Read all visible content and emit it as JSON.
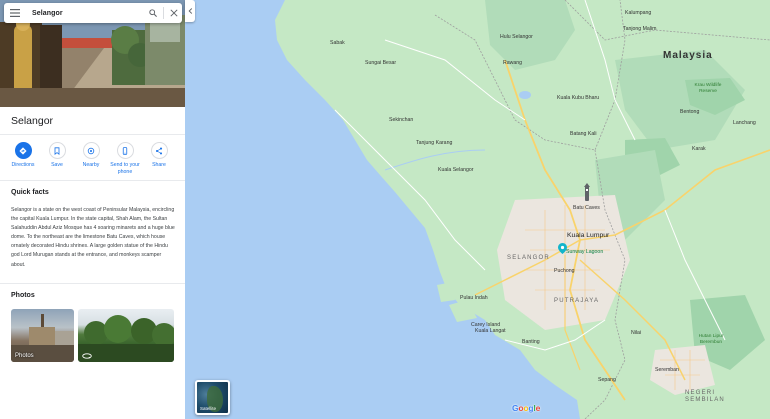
{
  "search": {
    "query": "Selangor"
  },
  "place": {
    "title": "Selangor"
  },
  "actions": [
    {
      "label": "Directions"
    },
    {
      "label": "Save"
    },
    {
      "label": "Nearby"
    },
    {
      "label": "Send to your phone"
    },
    {
      "label": "Share"
    }
  ],
  "quick_facts": {
    "heading": "Quick facts",
    "text": "Selangor is a state on the west coast of Peninsular Malaysia, encircling the capital Kuala Lumpur. In the state capital, Shah Alam, the Sultan Salahuddin Abdul Aziz Mosque has 4 soaring minarets and a huge blue dome. To the northeast are the limestone Batu Caves, which house ornately decorated Hindu shrines. A large golden statue of the Hindu god Lord Murugan stands at the entrance, and monkeys scamper about."
  },
  "photos": {
    "heading": "Photos",
    "first_label": "Photos"
  },
  "map": {
    "country_label": "Malaysia",
    "state_labels": {
      "selangor": "SELANGOR",
      "putrajaya": "PUTRAJAYA",
      "negeri_sembilan": "NEGERI SEMBILAN"
    },
    "cities": {
      "kuala_lumpur": "Kuala Lumpur",
      "batu_caves": "Batu Caves",
      "puchong": "Puchong",
      "sunway_lagoon": "Sunway Lagoon"
    },
    "towns": {
      "kuala_selangor": "Kuala Selangor",
      "sekinchan": "Sekinchan",
      "tanjung_karang": "Tanjung Karang",
      "kuala_kubu_bharu": "Kuala Kubu Bharu",
      "batang_kali": "Batang Kali",
      "rawang": "Rawang",
      "bentong": "Bentong",
      "karak": "Karak",
      "lanchang": "Lanchang",
      "pulau_indah": "Pulau Indah",
      "carey_island": "Carey Island",
      "banting": "Banting",
      "sepang": "Sepang",
      "nilai": "Nilai",
      "seremban": "Seremban",
      "sungai_besar": "Sungai Besar",
      "sabak": "Sabak",
      "hulu_selangor": "Hulu Selangor",
      "kuala_langat": "Kuala Langat",
      "kalumpang": "Kalumpang",
      "tanjong_malim": "Tanjong Malim"
    },
    "parks": {
      "krau": "Krau Wildlife Reserve",
      "berembun": "Hutan Lipur Berembun"
    },
    "satellite_label": "Satellite",
    "google_logo": [
      "G",
      "o",
      "o",
      "g",
      "l",
      "e"
    ]
  },
  "colors": {
    "accent": "#1a73e8",
    "water": "#aacdf3",
    "land": "#c5e8c5",
    "urban": "#ebe6df",
    "park": "#a8dab5",
    "highway": "#f9d36b"
  }
}
